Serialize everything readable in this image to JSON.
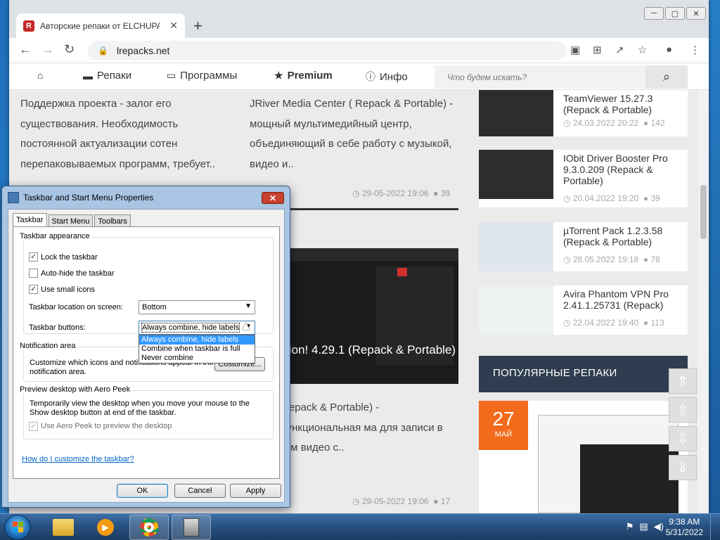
{
  "browser": {
    "tab_title": "Авторские репаки от ELCHUPACABRA",
    "tab_favicon": "R",
    "url": "lrepacks.net"
  },
  "site_nav": {
    "items": [
      {
        "label": "",
        "icon": "home-icon"
      },
      {
        "label": "Репаки",
        "icon": "car-icon"
      },
      {
        "label": "Программы",
        "icon": "folder-icon"
      },
      {
        "label": "Premium",
        "icon": "star-icon"
      },
      {
        "label": "Инфо",
        "icon": "info-icon"
      }
    ],
    "search_placeholder": "Что будем искать?"
  },
  "content": {
    "col1_text": "Поддержка проекта - залог его существования. Необходимость постоянной актуализации сотен перепаковываемых программ, требует..",
    "col2_text": "JRiver Media Center ( Repack & Portable) - мощный мультимедийный центр, объединяющий в себе работу с музыкой, видео и..",
    "col2_date": "29-05-2022 19:06",
    "col2_comments": "39",
    "post2_title": "illis Action! 4.29.1 (Repack & Portable)",
    "col2b_text": "ction! (Repack & Portable) - многофункциональная ма для записи в реальном видео с..",
    "col2b_date": "29-05-2022 19:06",
    "col2b_comments": "17"
  },
  "sidebar": {
    "items": [
      {
        "title": "TeamViewer 15.27.3 (Repack & Portable)",
        "date": "24.03.2022 20:22",
        "comments": "142"
      },
      {
        "title": "IObit Driver Booster Pro 9.3.0.209 (Repack & Portable)",
        "date": "20.04.2022 19:20",
        "comments": "39"
      },
      {
        "title": "µTorrent Pack 1.2.3.58 (Repack & Portable)",
        "date": "28.05.2022 19:18",
        "comments": "78"
      },
      {
        "title": "Avira Phantom VPN Pro 2.41.1.25731 (Repack)",
        "date": "22.04.2022 19:40",
        "comments": "113"
      }
    ],
    "popular_heading": "ПОПУЛЯРНЫЕ РЕПАКИ",
    "popular_day": "27",
    "popular_month": "МАЙ"
  },
  "dialog": {
    "title": "Taskbar and Start Menu Properties",
    "tabs": [
      "Taskbar",
      "Start Menu",
      "Toolbars"
    ],
    "group_appearance": "Taskbar appearance",
    "lock_taskbar": "Lock the taskbar",
    "auto_hide": "Auto-hide the taskbar",
    "small_icons": "Use small icons",
    "location_label": "Taskbar location on screen:",
    "location_value": "Bottom",
    "buttons_label": "Taskbar buttons:",
    "buttons_value": "Always combine, hide labels",
    "buttons_options": [
      "Always combine, hide labels",
      "Combine when taskbar is full",
      "Never combine"
    ],
    "group_notification": "Notification area",
    "notification_desc": "Customize which icons and notifications appear in the notification area.",
    "customize_btn": "Customize...",
    "group_peek": "Preview desktop with Aero Peek",
    "peek_desc": "Temporarily view the desktop when you move your mouse to the Show desktop button at end of the taskbar.",
    "use_peek": "Use Aero Peek to preview the desktop",
    "help_link": "How do I customize the taskbar?",
    "ok": "OK",
    "cancel": "Cancel",
    "apply": "Apply"
  },
  "taskbar": {
    "time": "9:38 AM",
    "date": "5/31/2022"
  }
}
